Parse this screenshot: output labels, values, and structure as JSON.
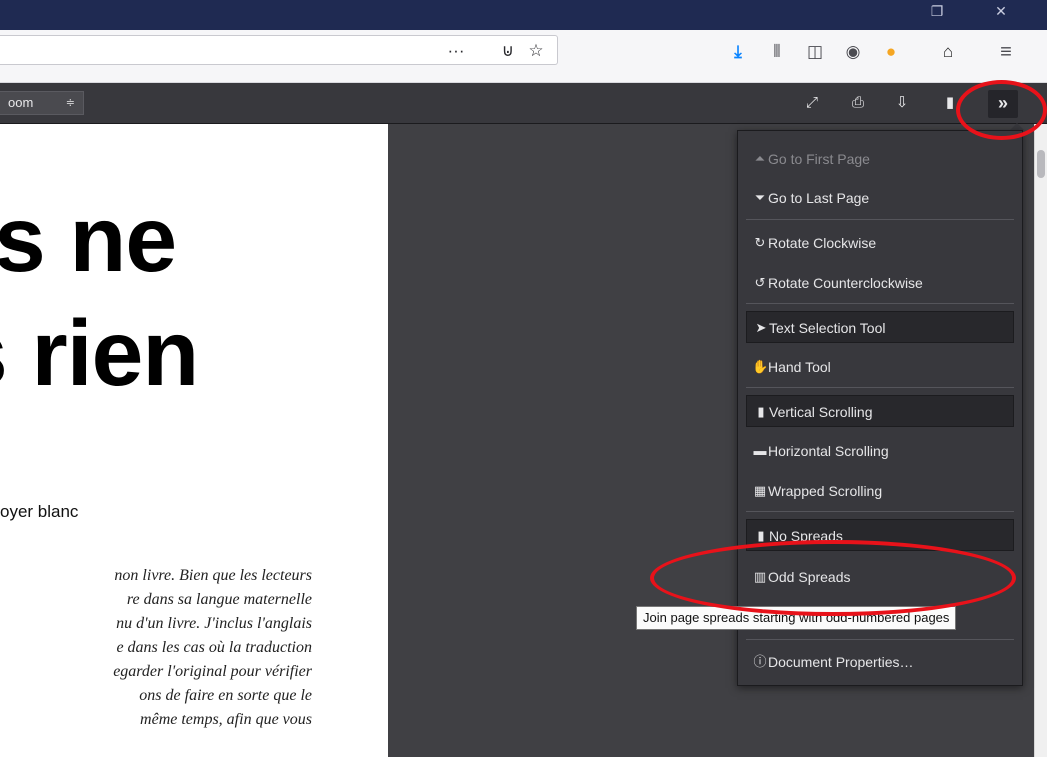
{
  "window": {
    "restore_glyph": "❐",
    "close_glyph": "✕"
  },
  "navbar": {
    "page_actions_glyph": "···",
    "pocket_glyph": "⊍",
    "bookmark_star_glyph": "☆",
    "download_glyph": "⤓",
    "library_glyph": "⫴",
    "sidebar_glyph": "◫",
    "account_glyph": "◉",
    "extension_glyph": "●",
    "gift_glyph": "⌂",
    "menu_glyph": "≡"
  },
  "pdf_toolbar": {
    "zoom_value": "oom",
    "zoom_caret": "≑",
    "presentation_glyph": "⤢",
    "print_glyph": "⎙",
    "save_glyph": "⇩",
    "bookmark_glyph": "▮",
    "tools_glyph": "»"
  },
  "document": {
    "title_line1": "s ne",
    "title_line2": "s rien",
    "subtitle": "oyer blanc",
    "paragraph_lines": [
      "non livre. Bien que les lecteurs",
      "re dans sa langue maternelle",
      "nu d'un livre. J'inclus l'anglais",
      "e dans les cas où la traduction",
      "egarder l'original pour vérifier",
      "ons de faire en sorte que le",
      " même temps, afin que vous"
    ]
  },
  "menu": {
    "items": [
      {
        "label": "Go to First Page",
        "icon": "⏶"
      },
      {
        "label": "Go to Last Page",
        "icon": "⏷"
      },
      {
        "label": "Rotate Clockwise",
        "icon": "↻"
      },
      {
        "label": "Rotate Counterclockwise",
        "icon": "↺"
      },
      {
        "label": "Text Selection Tool",
        "icon": "➤"
      },
      {
        "label": "Hand Tool",
        "icon": "✋"
      },
      {
        "label": "Vertical Scrolling",
        "icon": "▮"
      },
      {
        "label": "Horizontal Scrolling",
        "icon": "▬"
      },
      {
        "label": "Wrapped Scrolling",
        "icon": "▦"
      },
      {
        "label": "No Spreads",
        "icon": "▮"
      },
      {
        "label": "Odd Spreads",
        "icon": "▥"
      },
      {
        "label": "Document Properties…",
        "icon": "ⓘ"
      }
    ]
  },
  "tooltip": {
    "text": "Join page spreads starting with odd-numbered pages"
  },
  "annotation": {
    "color": "#e8121a"
  }
}
